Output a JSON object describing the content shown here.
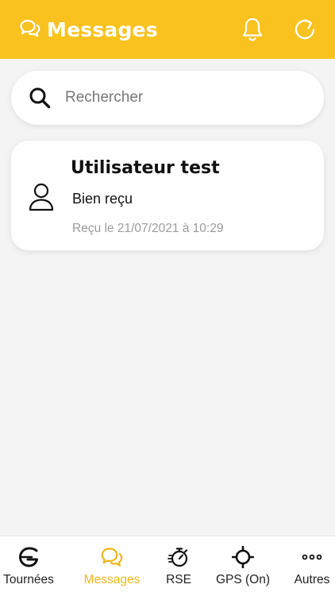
{
  "header": {
    "title": "Messages",
    "title_icon": "chat-bubbles-icon",
    "actions": [
      "bell-icon",
      "refresh-icon"
    ]
  },
  "search": {
    "placeholder": "Rechercher",
    "icon": "search-icon"
  },
  "conversations": [
    {
      "name": "Utilisateur test",
      "last_message": "Bien reçu",
      "date": "Reçu le 21/07/2021 à 10:29",
      "icon": "user-icon"
    }
  ],
  "tabbar": {
    "active": "Messages",
    "items": [
      {
        "label": "Tournées",
        "icon": "g-logo-icon"
      },
      {
        "label": "Messages",
        "icon": "chat-bubbles-icon"
      },
      {
        "label": "RSE",
        "icon": "stopwatch-icon"
      },
      {
        "label": "GPS (On)",
        "icon": "crosshair-icon"
      },
      {
        "label": "Autres",
        "icon": "more-dots-icon"
      }
    ]
  },
  "colors": {
    "accent": "#f9c21f",
    "active_tab": "#f0b61a",
    "background": "#f4f4f4"
  }
}
